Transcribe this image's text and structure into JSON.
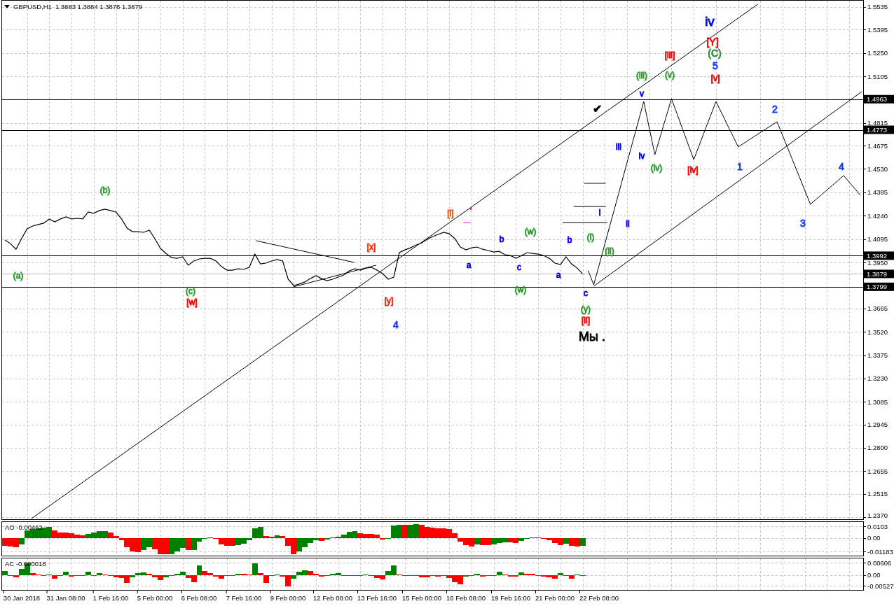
{
  "chart": {
    "header": {
      "title": "GBPUSD,H1",
      "quote": "1.3883 1.3884 1.3878 1.3879"
    },
    "chart_data": {
      "type": "line",
      "grid": true,
      "categories": [
        null,
        null,
        null,
        null,
        null,
        null,
        null,
        null,
        null,
        null,
        null,
        null,
        null,
        null,
        null,
        null,
        null,
        null,
        null,
        null,
        null,
        null,
        null,
        null,
        null,
        null,
        null,
        null,
        null,
        null,
        null,
        null,
        null,
        null,
        null,
        null,
        null,
        null,
        null,
        null,
        null,
        null,
        null,
        null,
        null,
        null,
        null,
        null,
        null,
        null,
        null,
        null,
        null,
        null,
        null,
        null,
        null,
        null,
        null,
        null,
        null,
        null,
        null,
        null,
        null,
        null,
        null,
        null,
        null,
        null,
        null,
        null,
        null,
        null,
        null,
        null,
        null,
        null,
        null,
        null,
        null,
        null,
        null,
        null,
        null,
        null,
        null,
        null,
        null,
        null,
        null,
        null,
        null,
        null,
        null,
        null,
        null,
        null,
        null,
        null,
        null,
        null,
        null,
        null,
        null,
        null,
        null,
        null,
        null,
        null,
        null,
        null,
        null,
        null,
        null,
        null,
        null,
        null,
        null,
        null,
        null,
        null,
        null,
        null,
        null,
        null,
        null,
        null,
        null,
        null,
        null,
        null,
        null,
        null,
        null,
        null,
        null,
        null,
        null,
        null,
        null,
        null,
        null,
        null,
        null,
        null,
        null,
        null,
        null,
        null,
        null,
        null,
        null,
        null,
        null
      ],
      "series": [
        {
          "color": "#000000",
          "values": [
            1.4089,
            1.4067,
            1.4032,
            1.4098,
            1.4159,
            1.4176,
            1.4185,
            1.4194,
            1.422,
            1.4202,
            1.422,
            1.4233,
            1.422,
            1.4224,
            1.422,
            1.4263,
            1.4255,
            1.4272,
            1.4281,
            1.4272,
            1.4263,
            1.422,
            1.4163,
            1.4141,
            1.4141,
            1.4137,
            1.415,
            1.4098,
            1.4037,
            1.4006,
            1.398,
            1.3976,
            1.3985,
            1.3933,
            1.3959,
            1.3972,
            1.3976,
            1.3976,
            1.3959,
            1.3924,
            1.3902,
            1.3902,
            1.3911,
            1.3907,
            1.392,
            1.4002,
            1.3941,
            1.3946,
            1.3959,
            1.3968,
            1.3959,
            1.3846,
            1.3807,
            1.3816,
            1.3829,
            1.385,
            1.3868,
            1.385,
            1.3837,
            1.3846,
            1.3859,
            1.3872,
            1.3898,
            1.3911,
            1.3902,
            1.3915,
            1.392,
            1.3902,
            1.3881,
            1.3846,
            1.3859,
            1.4011,
            1.4028,
            1.4041,
            1.4058,
            1.4071,
            1.4093,
            1.4111,
            1.4124,
            1.4137,
            1.4128,
            1.4098,
            1.4046,
            1.4028,
            1.4041,
            1.4046,
            1.4032,
            1.4024,
            1.4015,
            1.4019,
            1.3998,
            1.3993,
            1.3976,
            1.3993,
            1.4011,
            1.4006,
            1.4002,
            1.3993,
            1.3976,
            1.3946,
            1.3937,
            1.3985,
            1.3941,
            1.3915,
            1.3879,
            null,
            null,
            null,
            null,
            null,
            null,
            null,
            null,
            null,
            null,
            null,
            null,
            null,
            null,
            null,
            null,
            null,
            null,
            null,
            null,
            null,
            null,
            null,
            null,
            null,
            null,
            null,
            null,
            null,
            null,
            null,
            null,
            null,
            null,
            null,
            null,
            null,
            null,
            null,
            null,
            null,
            null,
            null,
            null,
            null,
            null,
            null,
            null,
            null,
            null
          ]
        },
        {
          "color": "#000000",
          "values": [
            null,
            null,
            null,
            null,
            null,
            null,
            null,
            null,
            null,
            null,
            null,
            null,
            null,
            null,
            null,
            null,
            null,
            null,
            null,
            null,
            null,
            null,
            null,
            null,
            null,
            null,
            null,
            null,
            null,
            null,
            null,
            null,
            null,
            null,
            null,
            null,
            null,
            null,
            null,
            null,
            null,
            null,
            null,
            null,
            null,
            null,
            null,
            null,
            null,
            null,
            null,
            null,
            null,
            null,
            null,
            null,
            null,
            null,
            null,
            null,
            null,
            null,
            null,
            null,
            null,
            null,
            null,
            null,
            null,
            null,
            null,
            null,
            null,
            null,
            null,
            null,
            null,
            null,
            null,
            null,
            null,
            null,
            null,
            null,
            null,
            null,
            null,
            null,
            null,
            null,
            null,
            null,
            null,
            null,
            null,
            null,
            null,
            null,
            null,
            null,
            null,
            null,
            null,
            null,
            null,
            1.3899,
            1.3812,
            1.3938,
            1.4065,
            1.4191,
            1.4317,
            1.4444,
            1.457,
            1.4696,
            1.4823,
            1.4949,
            1.4784,
            1.4619,
            1.4735,
            1.485,
            1.4966,
            1.4872,
            1.4777,
            1.4683,
            1.4588,
            1.4678,
            1.4769,
            1.4859,
            1.4949,
            1.4879,
            1.4808,
            1.4738,
            1.4667,
            1.4689,
            1.4712,
            1.4734,
            1.4756,
            1.4778,
            1.4801,
            1.4823,
            1.4738,
            1.4652,
            1.4567,
            1.4482,
            1.4396,
            1.4311,
            1.4341,
            1.437,
            1.44,
            1.443,
            1.4459,
            1.4489,
            1.4448,
            1.4408,
            1.4367
          ]
        }
      ],
      "ylim": [
        1.2357,
        1.5574
      ],
      "yticks": [
        {
          "value": 1.5535,
          "label": "1.5535"
        },
        {
          "value": 1.5395,
          "label": "1.5395"
        },
        {
          "value": 1.525,
          "label": "1.5250"
        },
        {
          "value": 1.5105,
          "label": "1.5105"
        },
        {
          "value": 1.4815,
          "label": "1.4815"
        },
        {
          "value": 1.4675,
          "label": "1.4675"
        },
        {
          "value": 1.453,
          "label": "1.4530"
        },
        {
          "value": 1.4385,
          "label": "1.4385"
        },
        {
          "value": 1.424,
          "label": "1.4240"
        },
        {
          "value": 1.4095,
          "label": "1.4095"
        },
        {
          "value": 1.395,
          "label": "1.3950"
        },
        {
          "value": 1.3665,
          "label": "1.3665"
        },
        {
          "value": 1.352,
          "label": "1.3520"
        },
        {
          "value": 1.3375,
          "label": "1.3375"
        },
        {
          "value": 1.323,
          "label": "1.3230"
        },
        {
          "value": 1.3085,
          "label": "1.3085"
        },
        {
          "value": 1.2945,
          "label": "1.2945"
        },
        {
          "value": 1.28,
          "label": "1.2800"
        },
        {
          "value": 1.2655,
          "label": "1.2655"
        },
        {
          "value": 1.2515,
          "label": "1.2515"
        },
        {
          "value": 1.237,
          "label": "1.2370"
        }
      ],
      "ref_lines": [
        {
          "axis": "y",
          "value": 1.4963,
          "label": "1.4963",
          "color": "#000000"
        },
        {
          "axis": "y",
          "value": 1.4773,
          "label": "1.4773",
          "color": "#000000"
        },
        {
          "axis": "y",
          "value": 1.3992,
          "label": "1.3992",
          "color": "#000000"
        },
        {
          "axis": "y",
          "value": 1.3879,
          "label": "1.3879",
          "color": "#b8b8b8"
        },
        {
          "axis": "y",
          "value": 1.3799,
          "label": "1.3799",
          "color": "#000000"
        }
      ]
    },
    "wave_labels": [
      {
        "text": "iv",
        "kind": "intermediate",
        "color": "#0000ff"
      },
      {
        "text": "[Y]",
        "kind": "minor",
        "color": "#ff0000"
      },
      {
        "text": "[iii]",
        "kind": "minute",
        "color": "#ff0000"
      },
      {
        "text": "(C)",
        "kind": "minor",
        "color": "#2e8b3e"
      },
      {
        "text": "5",
        "kind": "minor",
        "color": "#1a3cf0"
      },
      {
        "text": "(iii)",
        "kind": "minute",
        "color": "#339933"
      },
      {
        "text": "(v)",
        "kind": "minute",
        "color": "#339933"
      },
      {
        "text": "[v]",
        "kind": "minute",
        "color": "#ff0000"
      },
      {
        "text": "v",
        "kind": "minute",
        "color": "#0000ff"
      },
      {
        "text": "✔",
        "kind": "mark"
      },
      {
        "text": "2",
        "kind": "minor",
        "color": "#1a3cf0"
      },
      {
        "text": "iii",
        "kind": "minute",
        "color": "#0000ff"
      },
      {
        "text": "iv",
        "kind": "minute",
        "color": "#0000ff"
      },
      {
        "text": "(iv)",
        "kind": "minute",
        "color": "#339933"
      },
      {
        "text": "[iv]",
        "kind": "minute",
        "color": "#ff0000"
      },
      {
        "text": "1",
        "kind": "minor",
        "color": "#1a3cf0"
      },
      {
        "text": "4",
        "kind": "minor",
        "color": "#1a3cf0"
      },
      {
        "text": "(b)",
        "kind": "minute",
        "color": "#339933"
      },
      {
        "text": "[i]",
        "kind": "minute",
        "color": "#e0601e"
      },
      {
        "text": "i",
        "kind": "minute",
        "color": "#0000ff"
      },
      {
        "text": "ii",
        "kind": "minute",
        "color": "#0000ff"
      },
      {
        "text": "3",
        "kind": "minor",
        "color": "#1a3cf0"
      },
      {
        "text": "(w)",
        "kind": "minute",
        "color": "#339933"
      },
      {
        "text": "b",
        "kind": "minute",
        "color": "#0000ff"
      },
      {
        "text": "b",
        "kind": "minute",
        "color": "#0000ff"
      },
      {
        "text": "(i)",
        "kind": "minute",
        "color": "#339933"
      },
      {
        "text": "[x]",
        "kind": "minute",
        "color": "#ff3300"
      },
      {
        "text": "(ii)",
        "kind": "minute",
        "color": "#339933"
      },
      {
        "text": "a",
        "kind": "minute",
        "color": "#0000ff"
      },
      {
        "text": "c",
        "kind": "minute",
        "color": "#0000ff"
      },
      {
        "text": "(a)",
        "kind": "minute",
        "color": "#339933"
      },
      {
        "text": "a",
        "kind": "minute",
        "color": "#0000ff"
      },
      {
        "text": "(c)",
        "kind": "minute",
        "color": "#339933"
      },
      {
        "text": "(w)",
        "kind": "minute",
        "color": "#339933"
      },
      {
        "text": "c",
        "kind": "minute",
        "color": "#0000ff"
      },
      {
        "text": "[w]",
        "kind": "minute",
        "color": "#ff0000"
      },
      {
        "text": "[y]",
        "kind": "minute",
        "color": "#e03020"
      },
      {
        "text": "(y)",
        "kind": "minute",
        "color": "#339933"
      },
      {
        "text": "4",
        "kind": "minor",
        "color": "#1a3cf0"
      },
      {
        "text": "[ii]",
        "kind": "minute",
        "color": "#ff0000"
      },
      {
        "text": "Мы .",
        "kind": "note"
      }
    ]
  },
  "ao": {
    "label": "AO -0.00462",
    "chart_data": {
      "type": "bar",
      "grid": true,
      "categories": [
        null,
        null,
        null,
        null,
        null,
        null,
        null,
        null,
        null,
        null,
        null,
        null,
        null,
        null,
        null,
        null,
        null,
        null,
        null,
        null,
        null,
        null,
        null,
        null,
        null,
        null,
        null,
        null,
        null,
        null,
        null,
        null,
        null,
        null,
        null,
        null,
        null,
        null,
        null,
        null,
        null,
        null,
        null,
        null,
        null,
        null,
        null,
        null,
        null,
        null,
        null,
        null,
        null,
        null,
        null,
        null,
        null,
        null,
        null,
        null,
        null,
        null,
        null,
        null,
        null,
        null,
        null,
        null,
        null,
        null,
        null,
        null,
        null,
        null,
        null,
        null,
        null,
        null,
        null,
        null,
        null,
        null,
        null,
        null,
        null,
        null,
        null,
        null,
        null,
        null,
        null,
        null,
        null,
        null,
        null,
        null,
        null,
        null,
        null,
        null,
        null,
        null,
        null,
        null,
        null,
        null,
        null,
        null,
        null,
        null,
        null,
        null,
        null,
        null,
        null,
        null,
        null,
        null,
        null,
        null,
        null,
        null,
        null,
        null,
        null,
        null,
        null,
        null,
        null,
        null,
        null,
        null,
        null,
        null,
        null,
        null,
        null,
        null,
        null,
        null,
        null,
        null,
        null,
        null,
        null,
        null,
        null,
        null,
        null,
        null,
        null,
        null,
        null,
        null,
        null
      ],
      "ylim": [
        -0.015518,
        0.013988
      ],
      "yticks": [
        {
          "value": 0.0103,
          "label": "0.0103"
        },
        {
          "value": 0,
          "label": "0.00"
        },
        {
          "value": -0.01183,
          "label": "-0.01183"
        }
      ],
      "series": [
        {
          "color": "#008000",
          "values": [
            null,
            null,
            null,
            -0.0054,
            0.0069,
            0.0076,
            0.0082,
            0.0091,
            0.0094,
            null,
            null,
            null,
            null,
            null,
            null,
            0.0037,
            0.0049,
            0.0057,
            0.0061,
            null,
            null,
            null,
            null,
            null,
            null,
            -0.0109,
            -0.0084,
            null,
            null,
            null,
            -0.014,
            -0.0116,
            -0.0088,
            null,
            -0.0103,
            -0.003,
            -0.001,
            0.0005,
            null,
            null,
            null,
            null,
            -0.0064,
            -0.0049,
            -0.0018,
            0.0082,
            0.0094,
            null,
            null,
            0.0024,
            null,
            null,
            null,
            -0.0118,
            -0.0084,
            -0.0046,
            -0.0019,
            null,
            -0.0012,
            0.0001,
            0.0012,
            0.003,
            0.0054,
            0.0058,
            null,
            null,
            null,
            null,
            null,
            -0.0005,
            0.0109,
            0.0118,
            null,
            0.0118,
            0.0121,
            null,
            null,
            null,
            null,
            null,
            null,
            null,
            null,
            null,
            null,
            -0.0057,
            null,
            null,
            -0.0058,
            -0.0045,
            -0.0037,
            null,
            null,
            -0.0027,
            -0.0003,
            0.0003,
            0.0004,
            null,
            null,
            null,
            null,
            -0.0049,
            null,
            null,
            -0.0067,
            null,
            null,
            null,
            null,
            null,
            null,
            null,
            null,
            null,
            null,
            null,
            null,
            null,
            null,
            null,
            null,
            null,
            null,
            null,
            null,
            null,
            null,
            null,
            null,
            null,
            null,
            null,
            null,
            null,
            null,
            null,
            null,
            null,
            null,
            null,
            null,
            null,
            null,
            null,
            null,
            null,
            null,
            null,
            null,
            null,
            null,
            null,
            null,
            null,
            null
          ]
        },
        {
          "color": "#ff0000",
          "values": [
            -0.0071,
            -0.0073,
            -0.0079,
            null,
            null,
            null,
            null,
            null,
            null,
            0.0069,
            0.0049,
            0.0046,
            0.0042,
            0.003,
            0.0024,
            null,
            null,
            null,
            null,
            0.0049,
            0.0019,
            -0.0018,
            -0.0079,
            -0.0121,
            -0.0124,
            null,
            null,
            -0.0098,
            -0.014,
            -0.0143,
            null,
            null,
            null,
            -0.0109,
            null,
            null,
            null,
            null,
            -0.001,
            -0.0054,
            -0.0069,
            -0.0071,
            null,
            null,
            null,
            null,
            null,
            0.0019,
            0.0012,
            null,
            0.0015,
            -0.0067,
            -0.0143,
            null,
            null,
            null,
            null,
            -0.0024,
            null,
            null,
            null,
            null,
            null,
            null,
            0.0042,
            0.0034,
            0.0033,
            0.0027,
            -0.0012,
            null,
            null,
            null,
            0.0116,
            null,
            null,
            0.0118,
            0.0097,
            0.0091,
            0.0086,
            0.0082,
            0.0079,
            0.0039,
            -0.0034,
            -0.0061,
            -0.0073,
            null,
            -0.0061,
            -0.0064,
            null,
            null,
            null,
            -0.0039,
            -0.0042,
            null,
            null,
            null,
            null,
            -0.0003,
            -0.0019,
            -0.0045,
            -0.0064,
            null,
            -0.0069,
            -0.0073,
            null,
            null,
            null,
            null,
            null,
            null,
            null,
            null,
            null,
            null,
            null,
            null,
            null,
            null,
            null,
            null,
            null,
            null,
            null,
            null,
            null,
            null,
            null,
            null,
            null,
            null,
            null,
            null,
            null,
            null,
            null,
            null,
            null,
            null,
            null,
            null,
            null,
            null,
            null,
            null,
            null,
            null,
            null,
            null,
            null,
            null,
            null,
            null,
            null,
            null,
            null
          ]
        }
      ]
    }
  },
  "ac": {
    "label": "AC -0.000018",
    "chart_data": {
      "type": "bar",
      "grid": true,
      "categories": [
        null,
        null,
        null,
        "30 Jan 2018",
        null,
        null,
        null,
        null,
        null,
        null,
        null,
        "31 Jan 08:00",
        null,
        null,
        null,
        null,
        null,
        null,
        null,
        "1 Feb 16:00",
        null,
        null,
        null,
        null,
        null,
        null,
        null,
        "5 Feb 00:00",
        null,
        null,
        null,
        null,
        null,
        null,
        null,
        "6 Feb 08:00",
        null,
        null,
        null,
        null,
        null,
        null,
        null,
        "7 Feb 16:00",
        null,
        null,
        null,
        null,
        null,
        null,
        null,
        "9 Feb 00:00",
        null,
        null,
        null,
        null,
        null,
        null,
        null,
        "12 Feb 08:00",
        null,
        null,
        null,
        null,
        null,
        null,
        null,
        "13 Feb 16:00",
        null,
        null,
        null,
        null,
        null,
        null,
        null,
        "15 Feb 00:00",
        null,
        null,
        null,
        null,
        null,
        null,
        null,
        "16 Feb 08:00",
        null,
        null,
        null,
        null,
        null,
        null,
        null,
        "19 Feb 16:00",
        null,
        null,
        null,
        null,
        null,
        null,
        null,
        "21 Feb 00:00",
        null,
        null,
        null,
        null,
        null,
        null,
        null,
        "22 Feb 08:00",
        null,
        null,
        null,
        null,
        null,
        null,
        null,
        null,
        null,
        null,
        null,
        null,
        null,
        null,
        null,
        null,
        null,
        null,
        null,
        null,
        null,
        null,
        null,
        null,
        null,
        null,
        null,
        null,
        null,
        null,
        null,
        null,
        null,
        null,
        null,
        null,
        null,
        null,
        null,
        null,
        null,
        null,
        null,
        null,
        null,
        null,
        null
      ],
      "ylim": [
        -0.00733,
        0.00812
      ],
      "yticks": [
        {
          "value": 0.00606,
          "label": "0.00606"
        },
        {
          "value": 0,
          "label": "0.00"
        },
        {
          "value": -0.00527,
          "label": "-0.00527"
        }
      ],
      "series": [
        {
          "color": "#008000",
          "values": [
            0.0018,
            null,
            null,
            0.0031,
            0.0058,
            null,
            null,
            null,
            0.0003,
            null,
            -0.0004,
            0.0015,
            null,
            -0.0005,
            -0.0001,
            0.0015,
            null,
            0.0008,
            null,
            null,
            null,
            null,
            null,
            -0.0012,
            0.001,
            0.0014,
            null,
            null,
            null,
            -0.001,
            -0.0005,
            0.0007,
            0.0015,
            null,
            null,
            0.0048,
            null,
            null,
            null,
            null,
            -0.0005,
            null,
            0.0007,
            null,
            null,
            0.0058,
            null,
            null,
            -0.0005,
            0.0001,
            null,
            null,
            -0.002,
            0.0015,
            0.0022,
            null,
            null,
            null,
            -0.0004,
            0.0005,
            0.0008,
            null,
            null,
            null,
            -0.0001,
            0.0001,
            null,
            null,
            null,
            0.0018,
            0.0048,
            null,
            null,
            null,
            -0.0004,
            null,
            null,
            -0.0004,
            null,
            -0.0003,
            null,
            null,
            null,
            -0.0008,
            -0.0001,
            0.0005,
            null,
            -0.0003,
            -0.0001,
            0.0016,
            null,
            null,
            null,
            0.0014,
            null,
            null,
            null,
            null,
            null,
            null,
            0.001,
            null,
            null,
            0.0003,
            null,
            null,
            null,
            null,
            null,
            null,
            null,
            null,
            null,
            null,
            null,
            null,
            null,
            null,
            null,
            null,
            null,
            null,
            null,
            null,
            null,
            null,
            null,
            null,
            null,
            null,
            null,
            null,
            null,
            null,
            null,
            null,
            null,
            null,
            null,
            null,
            null,
            null,
            null,
            null,
            null,
            null,
            null,
            null,
            null,
            null,
            null,
            null,
            null,
            null,
            null
          ]
        },
        {
          "color": "#ff0000",
          "values": [
            null,
            -0.0001,
            -0.001,
            null,
            null,
            0.001,
            0.0001,
            -0.0001,
            null,
            -0.002,
            null,
            null,
            -0.0007,
            null,
            null,
            null,
            -0.0001,
            null,
            0.0001,
            -0.0005,
            -0.001,
            -0.0015,
            -0.0039,
            null,
            null,
            null,
            0.0004,
            -0.0012,
            -0.0026,
            null,
            null,
            null,
            null,
            -0.0016,
            -0.0034,
            null,
            0.002,
            0.0008,
            -0.0007,
            -0.0018,
            null,
            -0.0005,
            null,
            0.0007,
            0.0001,
            null,
            0.001,
            -0.0039,
            null,
            null,
            -0.0007,
            -0.0056,
            null,
            null,
            null,
            0.0018,
            0.0007,
            -0.0008,
            null,
            null,
            null,
            -0.0001,
            -0.0003,
            -0.0003,
            null,
            null,
            -0.0005,
            -0.0015,
            -0.0022,
            null,
            null,
            0.0003,
            -0.0004,
            -0.0005,
            null,
            -0.001,
            -0.001,
            null,
            -0.0007,
            null,
            -0.0015,
            -0.0034,
            -0.0045,
            null,
            null,
            null,
            -0.0007,
            null,
            null,
            null,
            0.0003,
            -0.0007,
            -0.0007,
            null,
            0.0007,
            0.0004,
            -0.0003,
            -0.0007,
            -0.001,
            -0.0019,
            null,
            -0.0004,
            -0.0019,
            null,
            -0.0001,
            null,
            null,
            null,
            null,
            null,
            null,
            null,
            null,
            null,
            null,
            null,
            null,
            null,
            null,
            null,
            null,
            null,
            null,
            null,
            null,
            null,
            null,
            null,
            null,
            null,
            null,
            null,
            null,
            null,
            null,
            null,
            null,
            null,
            null,
            null,
            null,
            null,
            null,
            null,
            null,
            null,
            null,
            null,
            null,
            null,
            null,
            null,
            null,
            null,
            null
          ]
        }
      ]
    }
  }
}
